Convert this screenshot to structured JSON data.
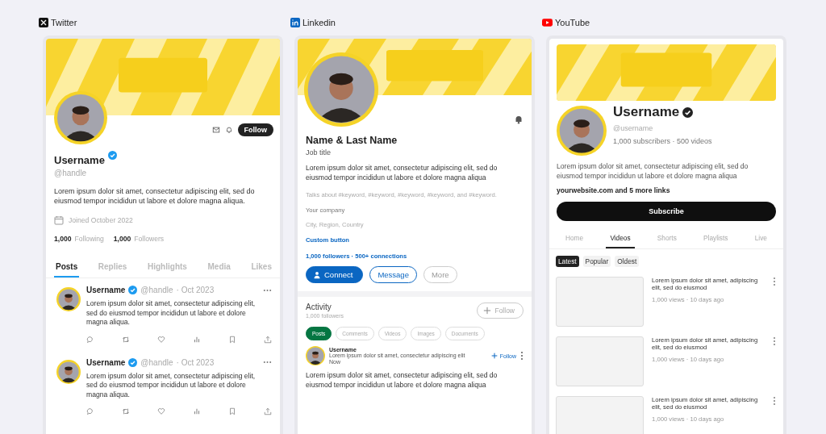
{
  "twitter": {
    "label": "Twitter",
    "name": "Username",
    "handle": "@handle",
    "follow_button": "Follow",
    "bio": "Lorem ipsum dolor sit amet, consectetur adipiscing elit, sed do eiusmod tempor incididun ut labore et dolore magna aliqua.",
    "joined": "Joined October 2022",
    "following_count": "1,000",
    "following_label": "Following",
    "followers_count": "1,000",
    "followers_label": "Followers",
    "tabs": [
      {
        "label": "Posts",
        "selected": true
      },
      {
        "label": "Replies",
        "selected": false
      },
      {
        "label": "Highlights",
        "selected": false
      },
      {
        "label": "Media",
        "selected": false
      },
      {
        "label": "Likes",
        "selected": false
      }
    ],
    "posts": [
      {
        "name": "Username",
        "handle": "@handle",
        "date": "· Oct 2023",
        "text": "Lorem ipsum dolor sit amet, consectetur adipiscing elit, sed do eiusmod tempor incididun ut labore et dolore magna aliqua."
      },
      {
        "name": "Username",
        "handle": "@handle",
        "date": "· Oct 2023",
        "text": "Lorem ipsum dolor sit amet, consectetur adipiscing elit, sed do eiusmod tempor incididun ut labore et dolore magna aliqua."
      }
    ]
  },
  "linkedin": {
    "label": "Linkedin",
    "name": "Name & Last Name",
    "job_title": "Job title",
    "bio": "Lorem ipsum dolor sit amet, consectetur adipiscing elit, sed do eiusmod tempor incididun ut labore et dolore magna aliqua",
    "talks_about": "Talks about #keyword, #keyword, #keyword, #keyword, and #keyword.",
    "company": "Your company",
    "location": "City, Region, Country",
    "custom_button": "Custom button",
    "network": "1,000 followers · 500+ connections",
    "buttons": [
      {
        "label": "Connect",
        "kind": "primary"
      },
      {
        "label": "Message",
        "kind": "outline"
      },
      {
        "label": "More",
        "kind": "plain"
      }
    ],
    "activity": {
      "title": "Activity",
      "followers": "1,000 followers",
      "follow_button": "Follow",
      "chips": [
        {
          "label": "Posts",
          "selected": true
        },
        {
          "label": "Comments",
          "selected": false
        },
        {
          "label": "Videos",
          "selected": false
        },
        {
          "label": "Images",
          "selected": false
        },
        {
          "label": "Documents",
          "selected": false
        }
      ],
      "post": {
        "name": "Username",
        "headline": "Lorem ipsum dolor sit amet, consectetur adipiscing elit",
        "time": "Now",
        "follow": "Follow",
        "text": "Lorem ipsum dolor sit amet, consectetur adipiscing elit, sed do eiusmod tempor incididun ut labore et dolore magna aliqua"
      }
    }
  },
  "youtube": {
    "label": "YouTube",
    "name": "Username",
    "handle": "@username",
    "stats": "1,000 subscribers · 500 videos",
    "bio": "Lorem ipsum dolor sit amet, consectetur adipiscing elit, sed do eiusmod tempor incididun ut labore et dolore magna aliqua",
    "links": "yourwebsite.com and 5 more links",
    "subscribe": "Subscribe",
    "tabs": [
      {
        "label": "Home",
        "selected": false
      },
      {
        "label": "Videos",
        "selected": true
      },
      {
        "label": "Shorts",
        "selected": false
      },
      {
        "label": "Playlists",
        "selected": false
      },
      {
        "label": "Live",
        "selected": false
      }
    ],
    "chips": [
      {
        "label": "Latest",
        "selected": true
      },
      {
        "label": "Popular",
        "selected": false
      },
      {
        "label": "Oldest",
        "selected": false
      }
    ],
    "videos": [
      {
        "title": "Lorem ipsum dolor sit amet, adipiscing elit, sed do eiusmod",
        "meta": "1,000 views · 10 days ago"
      },
      {
        "title": "Lorem ipsum dolor sit amet, adipiscing elit, sed do eiusmod",
        "meta": "1,000 views · 10 days ago"
      },
      {
        "title": "Lorem ipsum dolor sit amet, adipiscing elit, sed do eiusmod",
        "meta": "1,000 views · 10 days ago"
      }
    ]
  }
}
